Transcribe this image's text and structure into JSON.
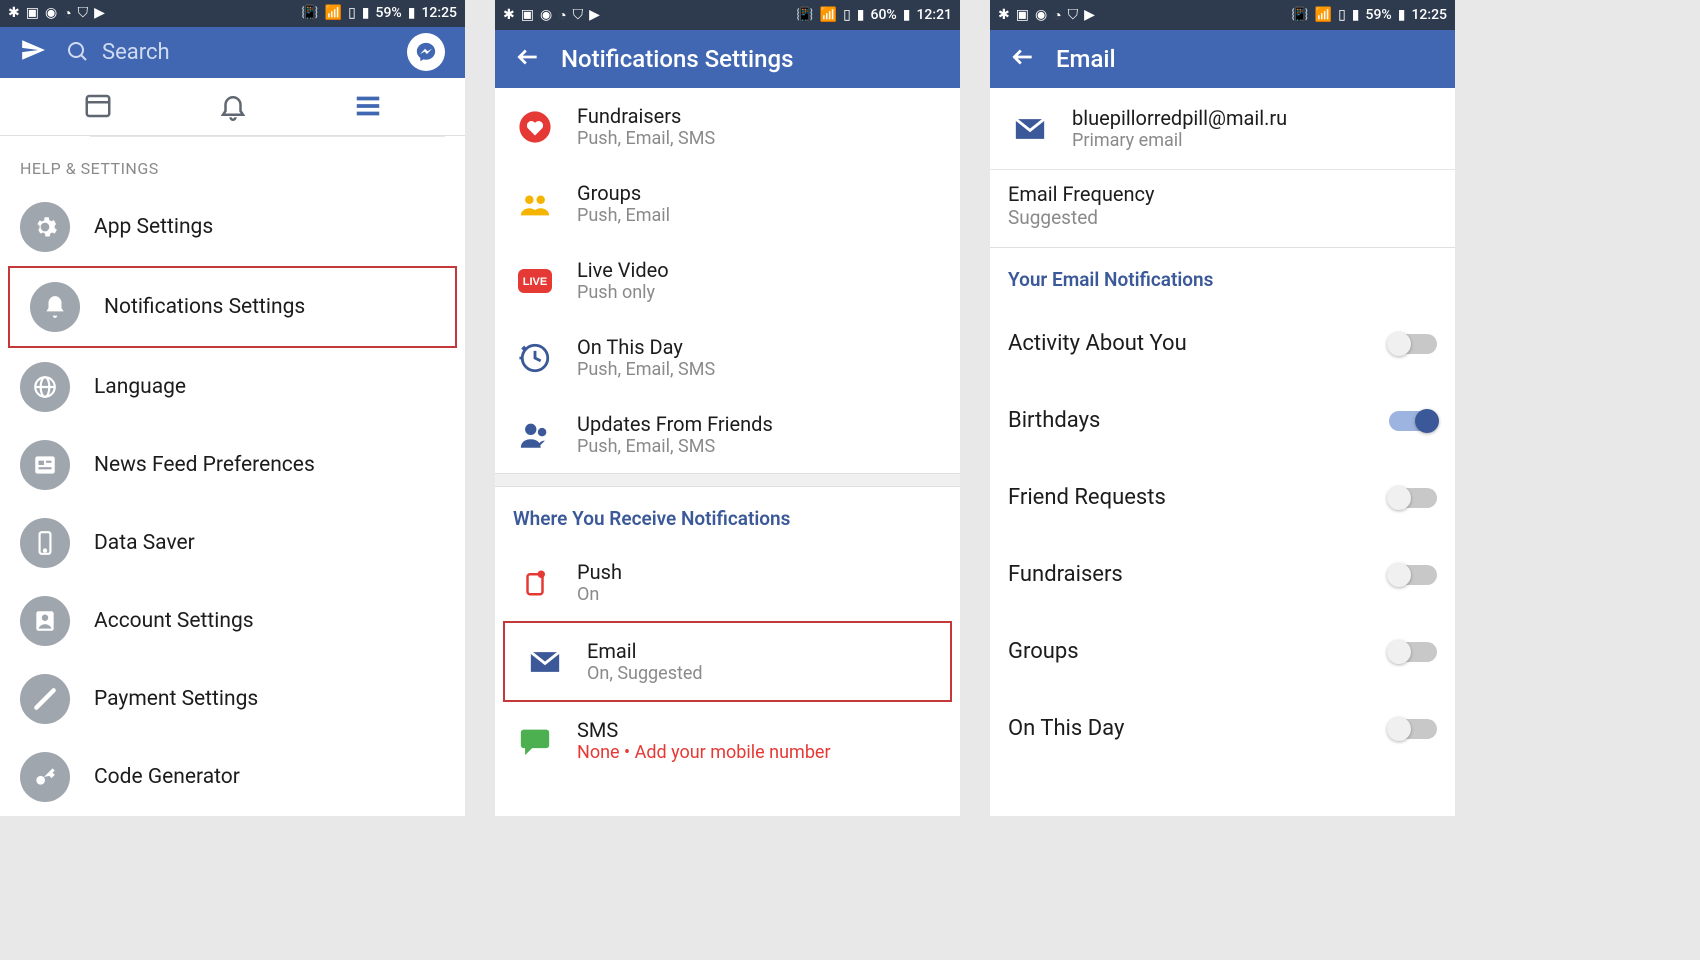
{
  "screens": [
    {
      "status": {
        "battery": "59%",
        "time": "12:25"
      },
      "header": {
        "search_placeholder": "Search"
      },
      "section_title": "HELP & SETTINGS",
      "menu": [
        {
          "label": "App Settings",
          "icon": "gear"
        },
        {
          "label": "Notifications Settings",
          "icon": "bell",
          "highlight": true
        },
        {
          "label": "Language",
          "icon": "globe"
        },
        {
          "label": "News Feed Preferences",
          "icon": "feed"
        },
        {
          "label": "Data Saver",
          "icon": "phone"
        },
        {
          "label": "Account Settings",
          "icon": "account"
        },
        {
          "label": "Payment Settings",
          "icon": "payment"
        },
        {
          "label": "Code Generator",
          "icon": "key"
        }
      ]
    },
    {
      "status": {
        "battery": "60%",
        "time": "12:21"
      },
      "header": {
        "title": "Notifications Settings"
      },
      "notif_items": [
        {
          "title": "Fundraisers",
          "sub": "Push, Email, SMS",
          "icon": "heart"
        },
        {
          "title": "Groups",
          "sub": "Push, Email",
          "icon": "groups"
        },
        {
          "title": "Live Video",
          "sub": "Push only",
          "icon": "live"
        },
        {
          "title": "On This Day",
          "sub": "Push, Email, SMS",
          "icon": "clock"
        },
        {
          "title": "Updates From Friends",
          "sub": "Push, Email, SMS",
          "icon": "friends"
        }
      ],
      "section_header": "Where You Receive Notifications",
      "channel_items": [
        {
          "title": "Push",
          "sub": "On",
          "icon": "push"
        },
        {
          "title": "Email",
          "sub": "On, Suggested",
          "icon": "email",
          "highlight": true
        },
        {
          "title": "SMS",
          "sub": "None",
          "sub_extra": " • Add your mobile number",
          "icon": "sms"
        }
      ]
    },
    {
      "status": {
        "battery": "59%",
        "time": "12:25"
      },
      "header": {
        "title": "Email"
      },
      "email": {
        "address": "bluepillorredpill@mail.ru",
        "label": "Primary email"
      },
      "frequency": {
        "title": "Email Frequency",
        "value": "Suggested"
      },
      "section_header": "Your Email Notifications",
      "toggles": [
        {
          "label": "Activity About You",
          "on": false
        },
        {
          "label": "Birthdays",
          "on": true
        },
        {
          "label": "Friend Requests",
          "on": false
        },
        {
          "label": "Fundraisers",
          "on": false
        },
        {
          "label": "Groups",
          "on": false
        },
        {
          "label": "On This Day",
          "on": false
        }
      ]
    }
  ]
}
